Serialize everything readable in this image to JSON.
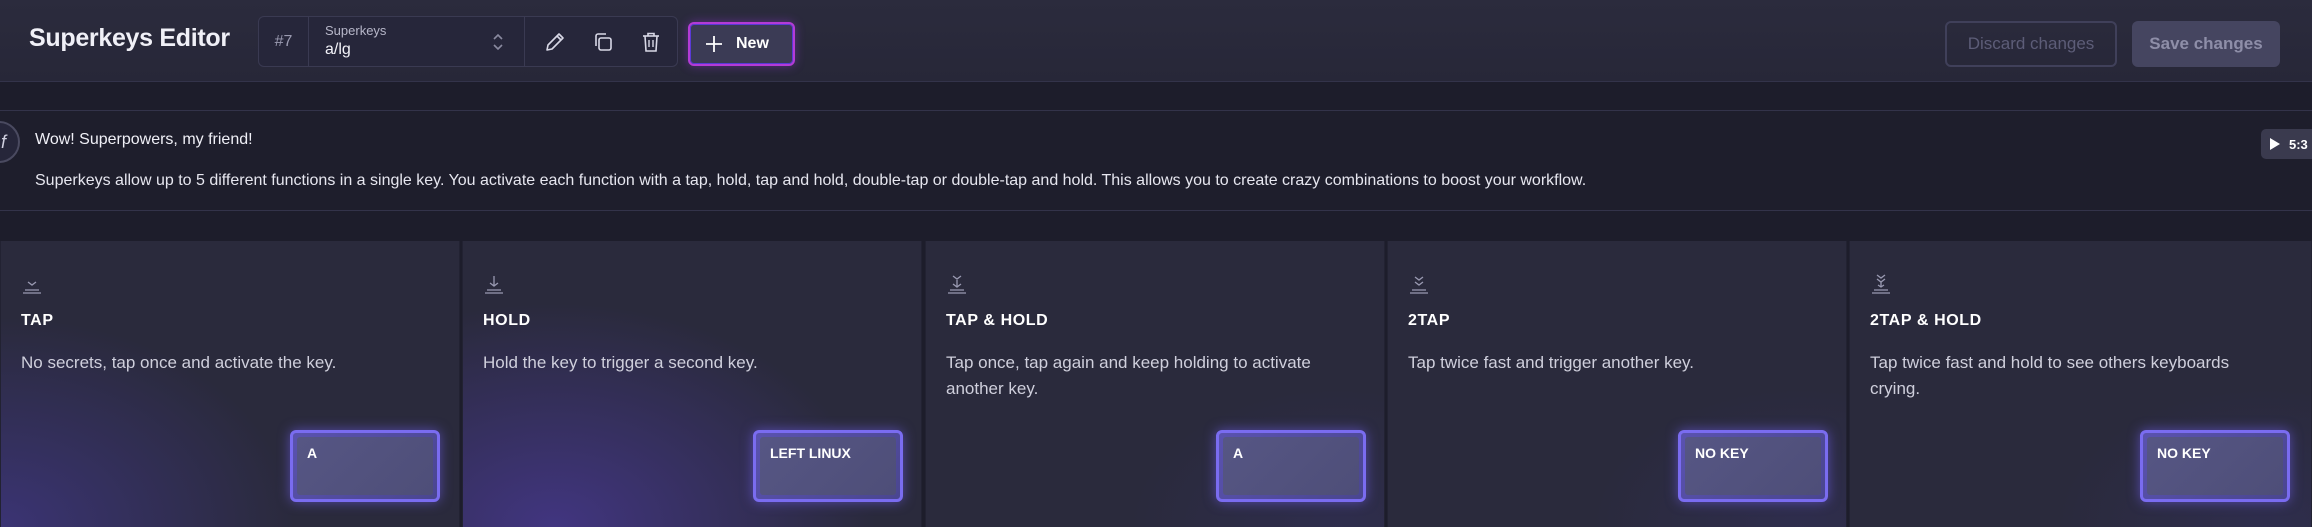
{
  "header": {
    "title": "Superkeys Editor",
    "selector": {
      "number": "#7",
      "label": "Superkeys",
      "value": "a/lg"
    },
    "new_label": "New",
    "discard_label": "Discard changes",
    "save_label": "Save changes"
  },
  "banner": {
    "avatar_glyph": "f",
    "title": "Wow! Superpowers, my friend!",
    "text": "Superkeys allow up to 5 different functions in a single key. You activate each function with a tap, hold, tap and hold, double-tap or double-tap and hold. This allows you to create crazy combinations to boost your workflow.",
    "video_duration": "5:3"
  },
  "cards": [
    {
      "title": "TAP",
      "description": "No secrets, tap once and activate the key.",
      "key": "A"
    },
    {
      "title": "HOLD",
      "description": "Hold the key to trigger a second key.",
      "key": "LEFT LINUX"
    },
    {
      "title": "TAP & HOLD",
      "description": "Tap once, tap again and keep holding to activate another key.",
      "key": "A"
    },
    {
      "title": "2TAP",
      "description": "Tap twice fast and trigger another key.",
      "key": "NO KEY"
    },
    {
      "title": "2TAP & HOLD",
      "description": "Tap twice fast and hold to see others keyboards crying.",
      "key": "NO KEY"
    }
  ],
  "colors": {
    "accent": "#7a6cf0",
    "new_border": "#b43bd6",
    "background": "#1d1d2b"
  }
}
